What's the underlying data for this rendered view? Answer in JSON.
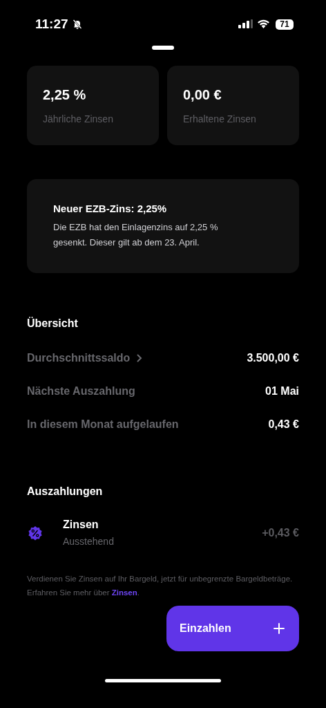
{
  "status_bar": {
    "time": "11:27",
    "silent": true,
    "battery": "71"
  },
  "stat_cards": [
    {
      "value": "2,25 %",
      "label": "Jährliche Zinsen"
    },
    {
      "value": "0,00 €",
      "label": "Erhaltene Zinsen"
    }
  ],
  "notice": {
    "title": "Neuer EZB-Zins: 2,25%",
    "body": "Die EZB hat den Einlagenzins auf 2,25 % gesenkt. Dieser gilt ab dem 23. April."
  },
  "overview": {
    "heading": "Übersicht",
    "rows": [
      {
        "kind": "link",
        "label": "Durchschnittssaldo",
        "value": "3.500,00 €"
      },
      {
        "kind": "plain",
        "label": "Nächste Auszahlung",
        "value": "01 Mai"
      },
      {
        "kind": "plain",
        "label": "In diesem Monat aufgelaufen",
        "value": "0,43 €"
      }
    ]
  },
  "payouts": {
    "heading": "Auszahlungen",
    "items": [
      {
        "title": "Zinsen",
        "status": "Ausstehend",
        "amount": "+0,43 €",
        "pending": true
      }
    ]
  },
  "footer": {
    "text": "Verdienen Sie Zinsen auf Ihr Bargeld, jetzt für unbegrenzte Bargeldbeträge. Erfahren Sie mehr über ",
    "link": "Zinsen",
    "after": "."
  },
  "deposit_button": {
    "label": "Einzahlen"
  }
}
